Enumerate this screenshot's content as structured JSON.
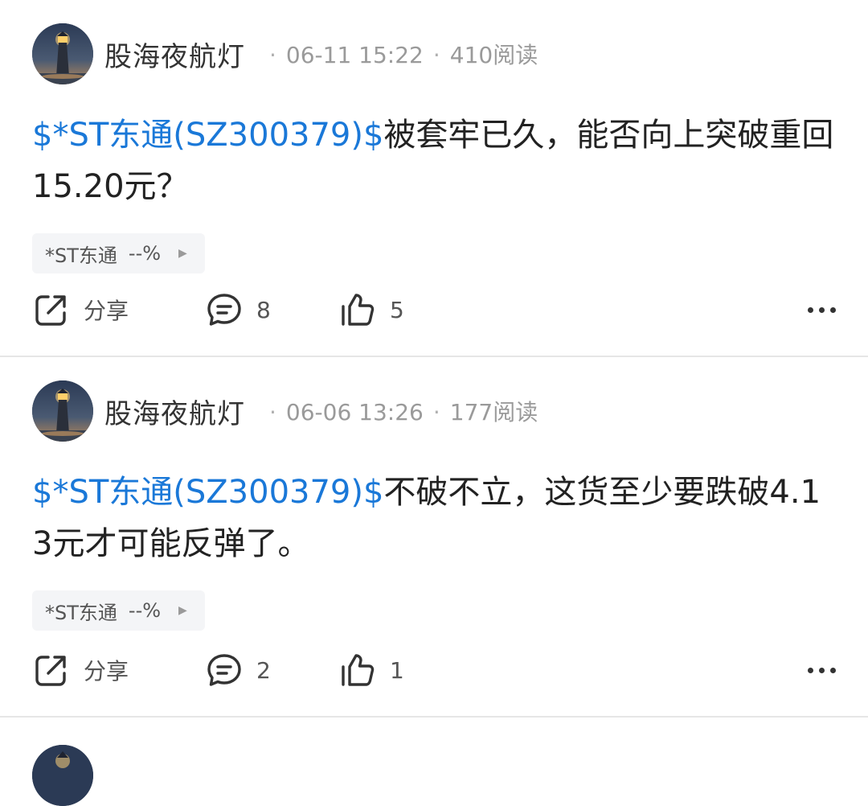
{
  "posts": [
    {
      "author": "股海夜航灯",
      "date": "06-11 15:22",
      "reads": "410阅读",
      "stock_tag": "$*ST东通(SZ300379)$",
      "text": "被套牢已久，能否向上突破重回15.20元？",
      "chip": {
        "name": "*ST东通",
        "change": "--%"
      },
      "share_label": "分享",
      "comments": "8",
      "likes": "5"
    },
    {
      "author": "股海夜航灯",
      "date": "06-06 13:26",
      "reads": "177阅读",
      "stock_tag": "$*ST东通(SZ300379)$",
      "text": "不破不立，这货至少要跌破4.13元才可能反弹了。",
      "chip": {
        "name": "*ST东通",
        "change": "--%"
      },
      "share_label": "分享",
      "comments": "2",
      "likes": "1"
    }
  ],
  "icons": {
    "share": "share-icon",
    "comment": "comment-icon",
    "like": "thumbs-up-icon",
    "more": "more-dots-icon",
    "chip_arrow": "play-triangle-icon"
  },
  "colors": {
    "link": "#1a78d8",
    "meta": "#9a9a9a",
    "chip_bg": "#f4f5f7",
    "divider": "#e6e6e6"
  }
}
